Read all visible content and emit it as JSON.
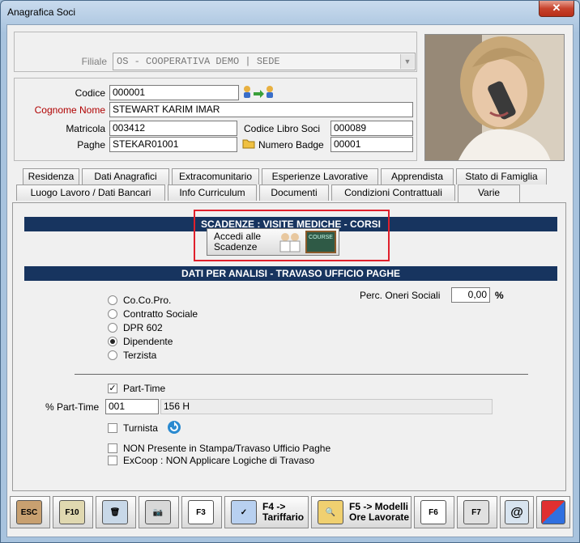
{
  "window": {
    "title": "Anagrafica Soci",
    "close_glyph": "✕"
  },
  "header": {
    "filiale_label": "Filiale",
    "filiale_value": "OS - COOPERATIVA DEMO | SEDE",
    "codice_label": "Codice",
    "codice_value": "000001",
    "cognome_label": "Cognome Nome",
    "cognome_value": "STEWART  KARIM IMAR",
    "matricola_label": "Matricola",
    "matricola_value": "003412",
    "libro_label": "Codice Libro Soci",
    "libro_value": "000089",
    "paghe_label": "Paghe",
    "paghe_value": "STEKAR01001",
    "badge_label": "Numero Badge",
    "badge_value": "00001"
  },
  "tabs": {
    "row1": [
      "Residenza",
      "Dati Anagrafici",
      "Extracomunitario",
      "Esperienze Lavorative",
      "Apprendista",
      "Stato di Famiglia"
    ],
    "row2": [
      "Luogo Lavoro / Dati Bancari",
      "Info Curriculum",
      "Documenti",
      "Condizioni Contrattuali",
      "Varie"
    ]
  },
  "panel": {
    "scadenze_header": "SCADENZE : VISITE MEDICHE - CORSI",
    "accedi_line1": "Accedi alle",
    "accedi_line2": "Scadenze",
    "course_text": "COURSE",
    "analisi_header": "DATI PER ANALISI - TRAVASO UFFICIO PAGHE",
    "radios": [
      "Co.Co.Pro.",
      "Contratto Sociale",
      "DPR 602",
      "Dipendente",
      "Terzista"
    ],
    "selected_radio": "Dipendente",
    "perc_label": "Perc. Oneri Sociali",
    "perc_value": "0,00",
    "perc_unit": "%",
    "parttime_label": "Part-Time",
    "parttime_checked": true,
    "pct_parttime_label": "% Part-Time",
    "pct_parttime_code": "001",
    "pct_parttime_desc": "156 H",
    "turnista_label": "Turnista",
    "nonpresente_label": "NON Presente in Stampa/Travaso Ufficio Paghe",
    "excoop_label": "ExCoop : NON Applicare Logiche di Travaso"
  },
  "toolbar": {
    "esc": "ESC",
    "f10": "F10",
    "note_f3": "F3",
    "f4_line1": "F4 ->",
    "f4_line2": "Tariffario",
    "f5_line1": "F5 -> Modelli",
    "f5_line2": "Ore Lavorate",
    "f6": "F6",
    "f7": "F7",
    "at": "@"
  }
}
